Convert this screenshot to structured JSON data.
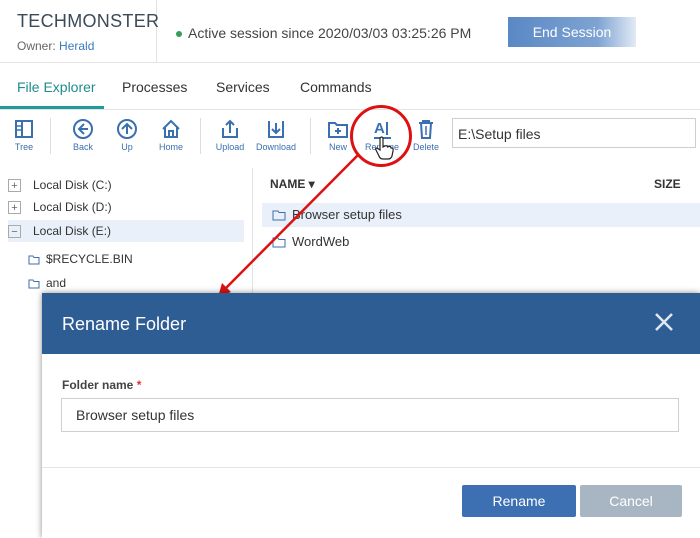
{
  "header": {
    "brand": "TECHMONSTER",
    "owner_prefix": "Owner:",
    "owner_name": "Herald",
    "session_text": "Active session since 2020/03/03 03:25:26 PM",
    "end_session_label": "End Session"
  },
  "tabs": [
    {
      "label": "File Explorer"
    },
    {
      "label": "Processes"
    },
    {
      "label": "Services"
    },
    {
      "label": "Commands"
    }
  ],
  "toolbar": {
    "tree": "Tree",
    "back": "Back",
    "up": "Up",
    "home": "Home",
    "upload": "Upload",
    "download": "Download",
    "new": "New",
    "rename": "Rename",
    "delete": "Delete",
    "path": "E:\\Setup files"
  },
  "tree": {
    "disks": [
      {
        "label": "Local Disk (C:)",
        "toggle": "+"
      },
      {
        "label": "Local Disk (D:)",
        "toggle": "+"
      },
      {
        "label": "Local Disk (E:)",
        "toggle": "−"
      }
    ],
    "children": [
      "$RECYCLE.BIN",
      "and"
    ]
  },
  "file_list": {
    "col_name": "NAME",
    "col_size": "SIZE",
    "rows": [
      "Browser setup files",
      "WordWeb"
    ]
  },
  "dialog": {
    "title": "Rename Folder",
    "field_label": "Folder name",
    "required_mark": "*",
    "field_value": "Browser setup files",
    "rename_label": "Rename",
    "cancel_label": "Cancel"
  },
  "colors": {
    "accent_teal": "#1f9b9b",
    "dialog_header": "#2e5d94",
    "primary_button": "#3d6fb3",
    "annotation_red": "#d11111"
  }
}
